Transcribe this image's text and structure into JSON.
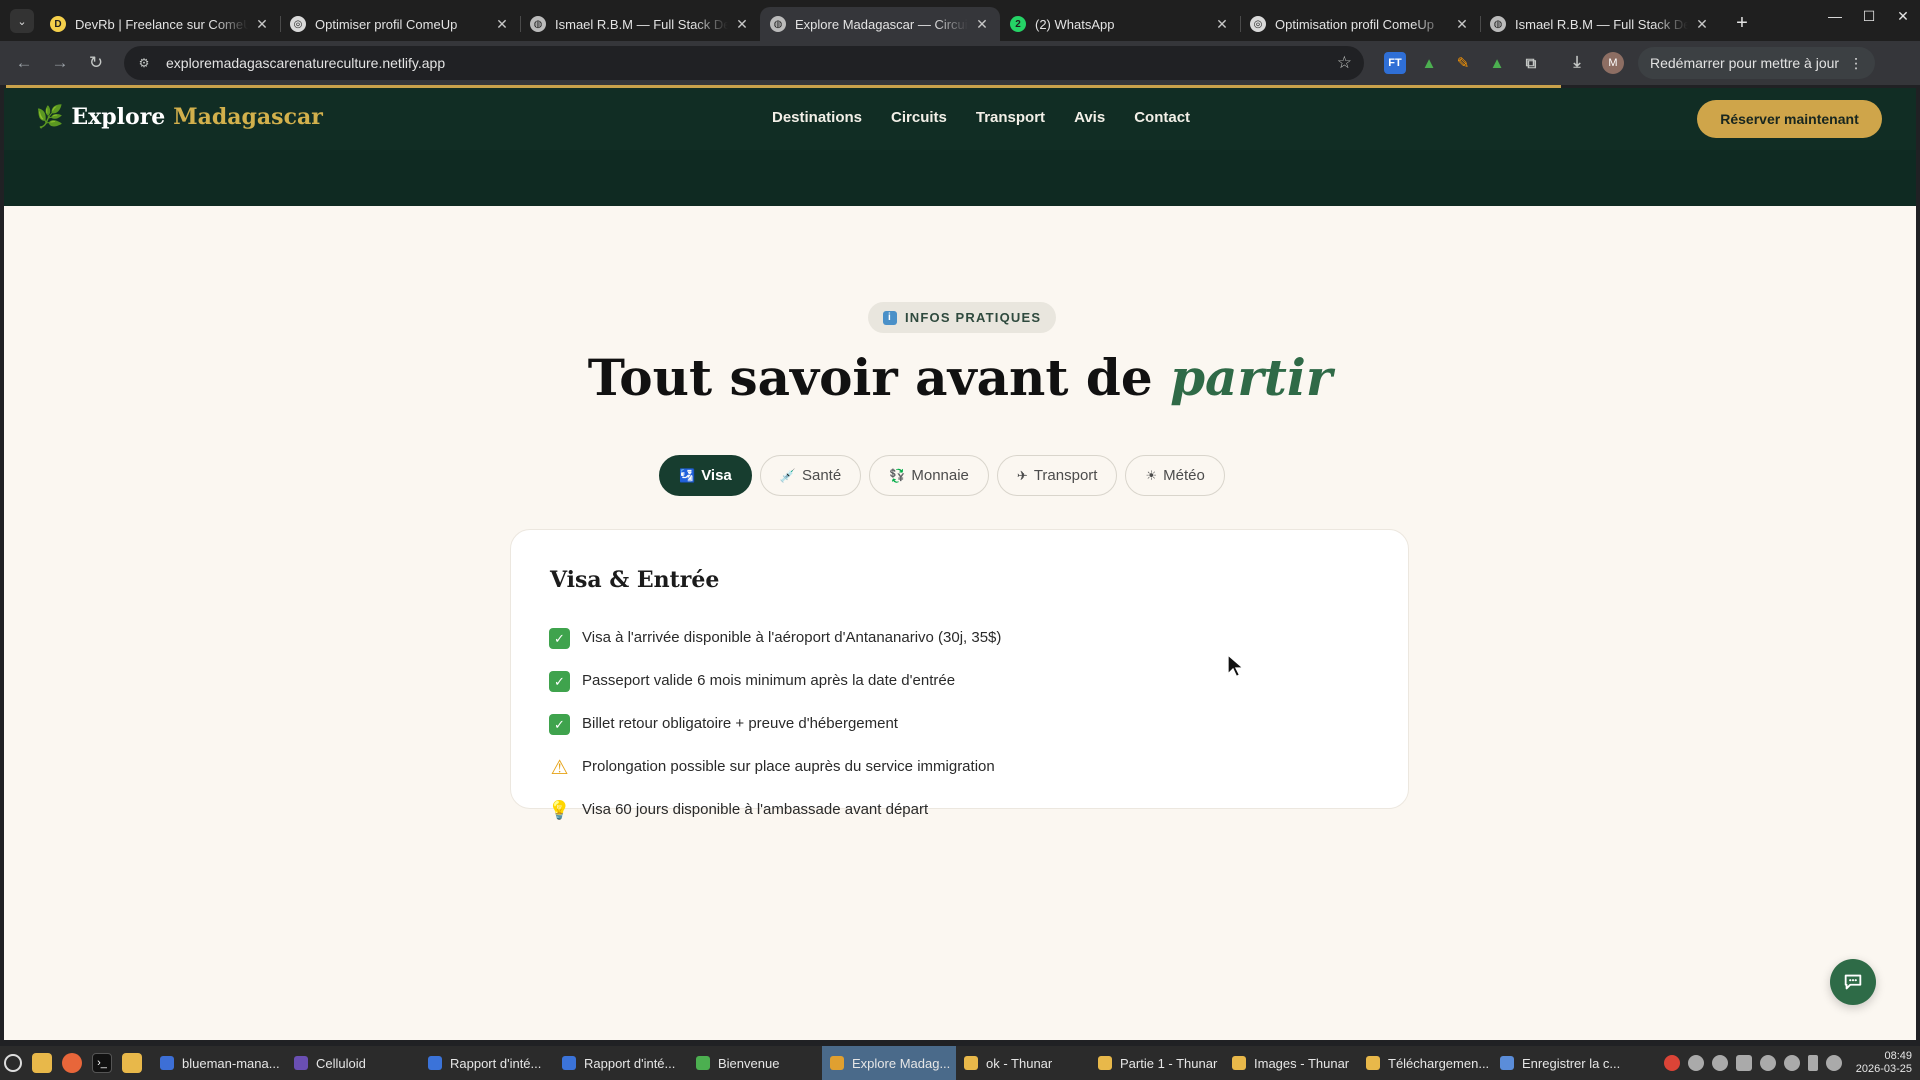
{
  "browser": {
    "tabs": [
      {
        "title": "DevRb | Freelance sur ComeUp",
        "favicon_color": "#f5d04b",
        "favicon_glyph": "D"
      },
      {
        "title": "Optimiser profil ComeUp",
        "favicon_color": "#d9d9d9",
        "favicon_glyph": "◎"
      },
      {
        "title": "Ismael R.B.M — Full Stack Developer",
        "favicon_color": "#bbbbbb",
        "favicon_glyph": "◍"
      },
      {
        "title": "Explore Madagascar — Circuits",
        "favicon_color": "#bbbbbb",
        "favicon_glyph": "◍",
        "active": true
      },
      {
        "title": "(2) WhatsApp",
        "favicon_color": "#25d366",
        "favicon_glyph": "2"
      },
      {
        "title": "Optimisation profil ComeUp",
        "favicon_color": "#d9d9d9",
        "favicon_glyph": "◎"
      },
      {
        "title": "Ismael R.B.M — Full Stack Developer",
        "favicon_color": "#bbbbbb",
        "favicon_glyph": "◍"
      }
    ],
    "url": "exploremadagascarenatureculture.netlify.app",
    "update_label": "Redémarrer pour mettre à jour",
    "profile_initial": "M"
  },
  "site": {
    "logo_text": "Explore",
    "logo_accent": "Madagascar",
    "nav": [
      "Destinations",
      "Circuits",
      "Transport",
      "Avis",
      "Contact"
    ],
    "cta_label": "Réserver maintenant",
    "colors": {
      "dark_green": "#112d24",
      "gold": "#cfa54a",
      "accent_green": "#2f6a47",
      "background": "#fbf7f1"
    }
  },
  "section": {
    "badge_label": "INFOS PRATIQUES",
    "title_main": "Tout savoir avant de",
    "title_accent": "partir",
    "tabs": [
      {
        "label": "Visa",
        "icon": "🛂",
        "active": true
      },
      {
        "label": "Santé",
        "icon": "💉"
      },
      {
        "label": "Monnaie",
        "icon": "💱"
      },
      {
        "label": "Transport",
        "icon": "✈"
      },
      {
        "label": "Météo",
        "icon": "☀"
      }
    ],
    "card": {
      "title": "Visa & Entrée",
      "items": [
        {
          "icon": "check-icon",
          "text": "Visa à l'arrivée disponible à l'aéroport d'Antananarivo (30j, 35$)"
        },
        {
          "icon": "check-icon",
          "text": "Passeport valide 6 mois minimum après la date d'entrée"
        },
        {
          "icon": "check-icon",
          "text": "Billet retour obligatoire + preuve d'hébergement"
        },
        {
          "icon": "warning-icon",
          "text": "Prolongation possible sur place auprès du service immigration"
        },
        {
          "icon": "lightbulb-icon",
          "text": "Visa 60 jours disponible à l'ambassade avant départ"
        }
      ]
    }
  },
  "taskbar": {
    "windows": [
      {
        "label": "blueman-mana...",
        "color": "#3d6fd6"
      },
      {
        "label": "Celluloid",
        "color": "#6a4fb3"
      },
      {
        "label": "Rapport d'inté...",
        "color": "#3b73d9"
      },
      {
        "label": "Rapport d'inté...",
        "color": "#3b73d9"
      },
      {
        "label": "Bienvenue",
        "color": "#4caf50"
      },
      {
        "label": "Explore Madag...",
        "color": "#e0a030",
        "active": true
      },
      {
        "label": "ok - Thunar",
        "color": "#e8b84a"
      },
      {
        "label": "Partie 1 - Thunar",
        "color": "#e8b84a"
      },
      {
        "label": "Images - Thunar",
        "color": "#e8b84a"
      },
      {
        "label": "Téléchargemen...",
        "color": "#e8b84a"
      },
      {
        "label": "Enregistrer la c...",
        "color": "#5b8dd9"
      }
    ],
    "time": "08:49",
    "date": "2026-03-25"
  }
}
